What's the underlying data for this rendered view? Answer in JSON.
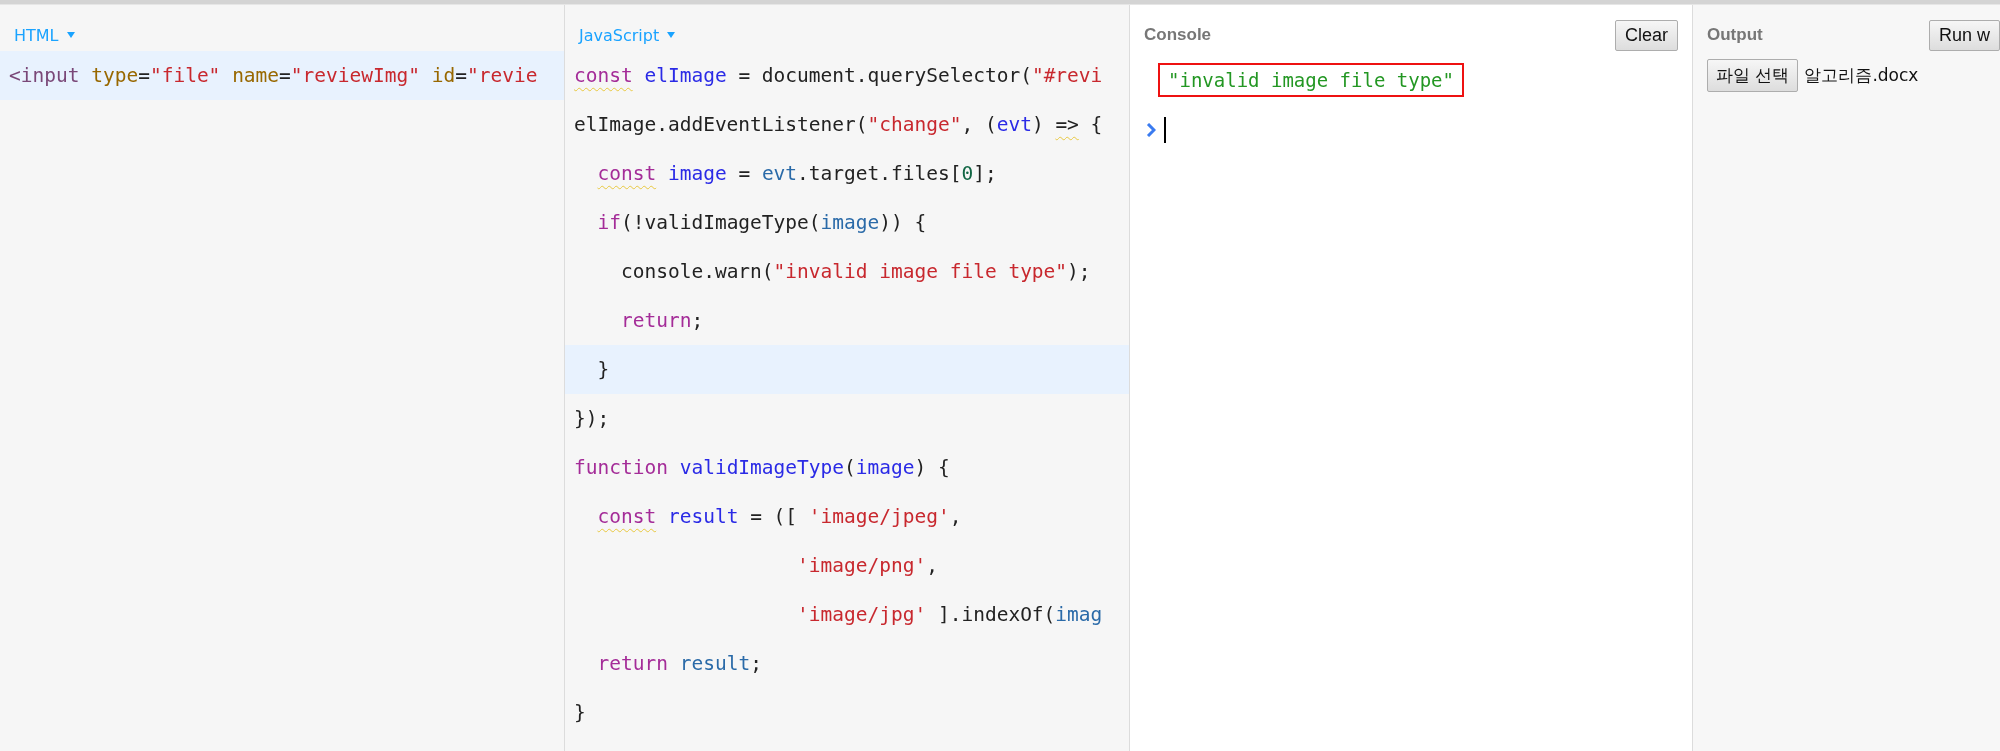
{
  "html_panel": {
    "tab": "HTML",
    "lines": [
      {
        "highlighted": true,
        "tokens": [
          {
            "text": "<input",
            "kind": "tag"
          },
          {
            "text": " type",
            "kind": "attr"
          },
          {
            "text": "=",
            "kind": "plain"
          },
          {
            "text": "\"file\"",
            "kind": "string"
          },
          {
            "text": " name",
            "kind": "attr"
          },
          {
            "text": "=",
            "kind": "plain"
          },
          {
            "text": "\"reviewImg\"",
            "kind": "string"
          },
          {
            "text": " id",
            "kind": "attr"
          },
          {
            "text": "=",
            "kind": "plain"
          },
          {
            "text": "\"revie",
            "kind": "string"
          }
        ]
      }
    ]
  },
  "js_panel": {
    "tab": "JavaScript",
    "lines": [
      {
        "highlighted": false,
        "tokens": [
          {
            "text": "const",
            "kind": "keyword-lint"
          },
          {
            "text": " elImage",
            "kind": "def"
          },
          {
            "text": " = document.querySelector(",
            "kind": "plain"
          },
          {
            "text": "\"#revi",
            "kind": "string"
          }
        ]
      },
      {
        "highlighted": false,
        "tokens": [
          {
            "text": "elImage.addEventListener(",
            "kind": "plain"
          },
          {
            "text": "\"change\"",
            "kind": "string"
          },
          {
            "text": ", (",
            "kind": "plain"
          },
          {
            "text": "evt",
            "kind": "def"
          },
          {
            "text": ") ",
            "kind": "plain"
          },
          {
            "text": "=>",
            "kind": "plain-lint"
          },
          {
            "text": " {",
            "kind": "plain"
          }
        ]
      },
      {
        "highlighted": false,
        "tokens": [
          {
            "text": "  const",
            "kind": "keyword-lint"
          },
          {
            "text": " image",
            "kind": "def"
          },
          {
            "text": " = ",
            "kind": "plain"
          },
          {
            "text": "evt",
            "kind": "variable"
          },
          {
            "text": ".target.files[",
            "kind": "plain"
          },
          {
            "text": "0",
            "kind": "number"
          },
          {
            "text": "];",
            "kind": "plain"
          }
        ]
      },
      {
        "highlighted": false,
        "tokens": [
          {
            "text": "  if",
            "kind": "keyword"
          },
          {
            "text": "(!validImageType(",
            "kind": "plain"
          },
          {
            "text": "image",
            "kind": "variable"
          },
          {
            "text": ")) {",
            "kind": "plain"
          }
        ]
      },
      {
        "highlighted": false,
        "tokens": [
          {
            "text": "    console.warn(",
            "kind": "plain"
          },
          {
            "text": "\"invalid image file type\"",
            "kind": "string"
          },
          {
            "text": ");",
            "kind": "plain"
          }
        ]
      },
      {
        "highlighted": false,
        "tokens": [
          {
            "text": "    return",
            "kind": "keyword"
          },
          {
            "text": ";",
            "kind": "plain"
          }
        ]
      },
      {
        "highlighted": true,
        "tokens": [
          {
            "text": "  }",
            "kind": "plain"
          }
        ]
      },
      {
        "highlighted": false,
        "tokens": [
          {
            "text": "});",
            "kind": "plain"
          }
        ]
      },
      {
        "highlighted": false,
        "tokens": [
          {
            "text": "function",
            "kind": "keyword"
          },
          {
            "text": " validImageType",
            "kind": "def"
          },
          {
            "text": "(",
            "kind": "plain"
          },
          {
            "text": "image",
            "kind": "def"
          },
          {
            "text": ") {",
            "kind": "plain"
          }
        ]
      },
      {
        "highlighted": false,
        "tokens": [
          {
            "text": "  const",
            "kind": "keyword-lint"
          },
          {
            "text": " result",
            "kind": "def"
          },
          {
            "text": " = ([ ",
            "kind": "plain"
          },
          {
            "text": "'image/jpeg'",
            "kind": "string"
          },
          {
            "text": ",",
            "kind": "plain"
          }
        ]
      },
      {
        "highlighted": false,
        "tokens": [
          {
            "text": "                   'image/png'",
            "kind": "string"
          },
          {
            "text": ",",
            "kind": "plain"
          }
        ]
      },
      {
        "highlighted": false,
        "tokens": [
          {
            "text": "                   'image/jpg'",
            "kind": "string"
          },
          {
            "text": " ].indexOf(",
            "kind": "plain"
          },
          {
            "text": "imag",
            "kind": "variable"
          }
        ]
      },
      {
        "highlighted": false,
        "tokens": [
          {
            "text": "  return",
            "kind": "keyword"
          },
          {
            "text": " result",
            "kind": "variable"
          },
          {
            "text": ";",
            "kind": "plain"
          }
        ]
      },
      {
        "highlighted": false,
        "tokens": [
          {
            "text": "}",
            "kind": "plain"
          }
        ]
      }
    ]
  },
  "console": {
    "title": "Console",
    "clear_button": "Clear",
    "entries": [
      {
        "text": "\"invalid image file type\"",
        "boxed": true
      }
    ]
  },
  "output": {
    "title": "Output",
    "run_button": "Run w",
    "file_button": "파일 선택",
    "file_name": "알고리즘.docx"
  }
}
